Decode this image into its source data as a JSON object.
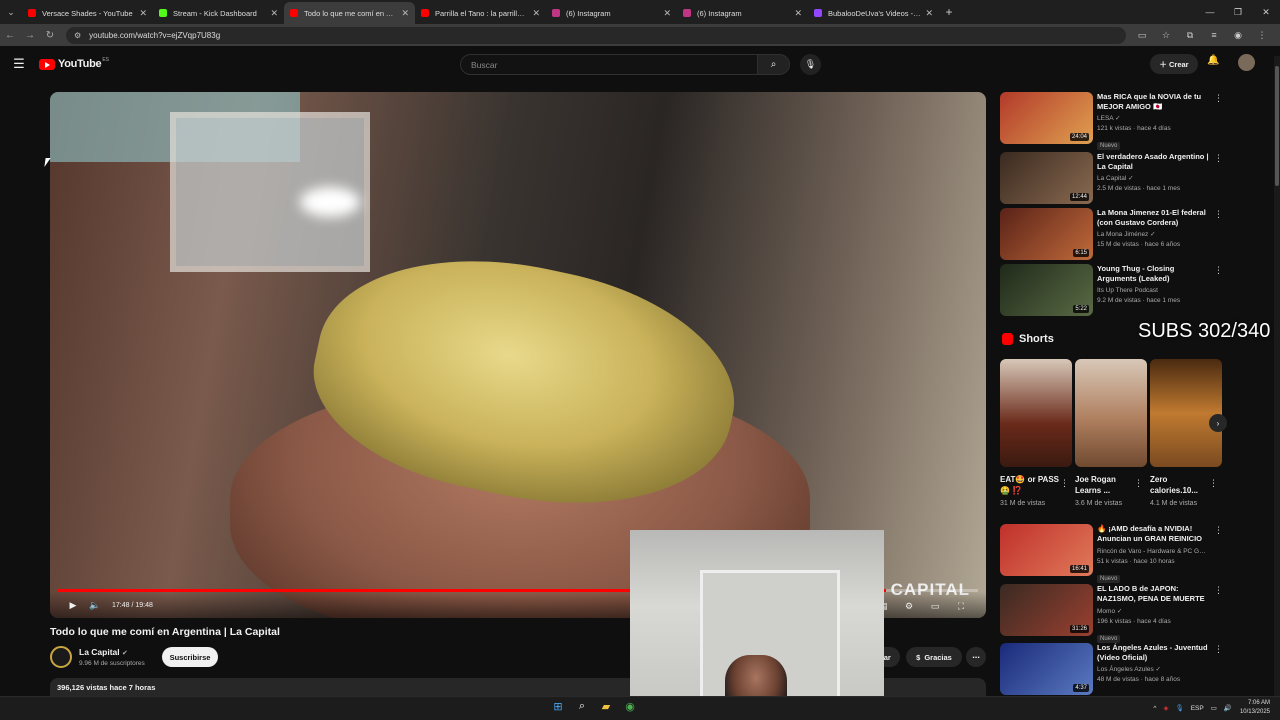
{
  "browser": {
    "tabs": [
      {
        "title": "Versace Shades - YouTube",
        "color": "#ff0000",
        "active": false
      },
      {
        "title": "Stream - Kick Dashboard",
        "color": "#53fc18",
        "active": false
      },
      {
        "title": "Todo lo que me comí en Argen",
        "color": "#ff0000",
        "active": true
      },
      {
        "title": "Parrilla el Tano : la parrilla libre",
        "color": "#ff0000",
        "active": false
      },
      {
        "title": "(6) Instagram",
        "color": "#c13584",
        "active": false
      },
      {
        "title": "(6) Instagram",
        "color": "#c13584",
        "active": false
      },
      {
        "title": "BubalooDeUva's Videos - Twitc",
        "color": "#9146ff",
        "active": false
      }
    ],
    "url": "youtube.com/watch?v=ejZVqp7U83g"
  },
  "header": {
    "logo_text": "YouTube",
    "country_code": "ES",
    "search_placeholder": "Buscar",
    "create_label": "Crear"
  },
  "player": {
    "time": "17:48 / 19:48",
    "progress_fraction": 0.9,
    "watermark": "CAPITAL"
  },
  "video": {
    "title": "Todo lo que me comí en Argentina | La Capital",
    "channel": "La Capital",
    "subscribers": "9.96 M de suscriptores",
    "subscribe_label": "Suscribirse",
    "save_label": "gar",
    "thanks_label": "Gracias",
    "views_line": "396,126 vistas  hace 7 horas"
  },
  "overlay": {
    "subs_counter": "SUBS 302/340"
  },
  "recommended": [
    {
      "title": "Mas RICA que la NOVIA de tu MEJOR AMIGO 🇯🇵",
      "channel": "LESA ✓",
      "meta": "121 k vistas · hace 4 días",
      "duration": "24:04",
      "badge": "Nuevo",
      "thumb": "#b23a2a"
    },
    {
      "title": "El verdadero Asado Argentino | La Capital",
      "channel": "La Capital ✓",
      "meta": "2.5 M de vistas · hace 1 mes",
      "duration": "12:44",
      "badge": "",
      "thumb": "#5a4535"
    },
    {
      "title": "La Mona Jimenez 01-El federal (con Gustavo Cordera)",
      "channel": "La Mona Jiménez ✓",
      "meta": "15 M de vistas · hace 6 años",
      "duration": "6:15",
      "badge": "",
      "thumb": "#8a3a28"
    },
    {
      "title": "Young Thug - Closing Arguments (Leaked)",
      "channel": "Its Up There Podcast",
      "meta": "9.2 M de vistas · hace 1 mes",
      "duration": "5:22",
      "badge": "",
      "thumb": "#3c4a34"
    }
  ],
  "shorts": {
    "heading": "Shorts",
    "items": [
      {
        "title": "EAT🤩 or PASS🤮 ⁉️",
        "views": "31 M de vistas",
        "thumb": "#6a2a1a"
      },
      {
        "title": "Joe Rogan Learns ...",
        "views": "3.6 M de vistas",
        "thumb": "#b08060"
      },
      {
        "title": "Zero calories.10...",
        "views": "4.1 M de vistas",
        "thumb": "#7a4a20"
      }
    ]
  },
  "recommended2": [
    {
      "title": "🔥 ¡AMD desafía a NVIDIA! Anuncian un GRAN REINICIO e...",
      "channel": "Rincón de Varo - Hardware & PC Gaming ✓",
      "meta": "51 k vistas · hace 10 horas",
      "duration": "16:41",
      "badge": "Nuevo",
      "thumb": "#c0302a"
    },
    {
      "title": "EL LADO B de JAPON: NAZ1SMO, PENA DE MUERTE ...",
      "channel": "Momo ✓",
      "meta": "196 k vistas · hace 4 días",
      "duration": "31:26",
      "badge": "Nuevo",
      "thumb": "#4a3a30"
    },
    {
      "title": "Los Ángeles Azules - Juventud (Video Oficial)",
      "channel": "Los Ángeles Azules ✓",
      "meta": "48 M de vistas · hace 8 años",
      "duration": "4:37",
      "badge": "",
      "thumb": "#2a3a8a"
    }
  ],
  "taskbar": {
    "lang": "ESP",
    "time": "7:06 AM",
    "date": "10/13/2025"
  }
}
